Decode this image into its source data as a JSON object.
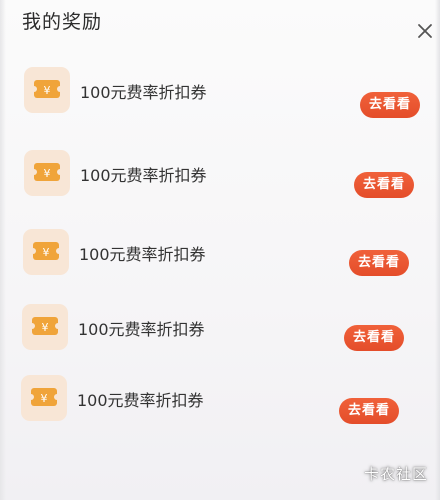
{
  "header": {
    "title": "我的奖励",
    "close_icon": "close-icon"
  },
  "rewards": [
    {
      "label": "100元费率折扣券",
      "button": "去看看",
      "icon": "coupon-icon"
    },
    {
      "label": "100元费率折扣券",
      "button": "去看看",
      "icon": "coupon-icon"
    },
    {
      "label": "100元费率折扣券",
      "button": "去看看",
      "icon": "coupon-icon"
    },
    {
      "label": "100元费率折扣券",
      "button": "去看看",
      "icon": "coupon-icon"
    },
    {
      "label": "100元费率折扣券",
      "button": "去看看",
      "icon": "coupon-icon"
    }
  ],
  "watermark": "卡农社区",
  "colors": {
    "accent": "#e9552f",
    "icon_bg": "#f8e6d6",
    "icon_fg": "#f0a43a"
  }
}
